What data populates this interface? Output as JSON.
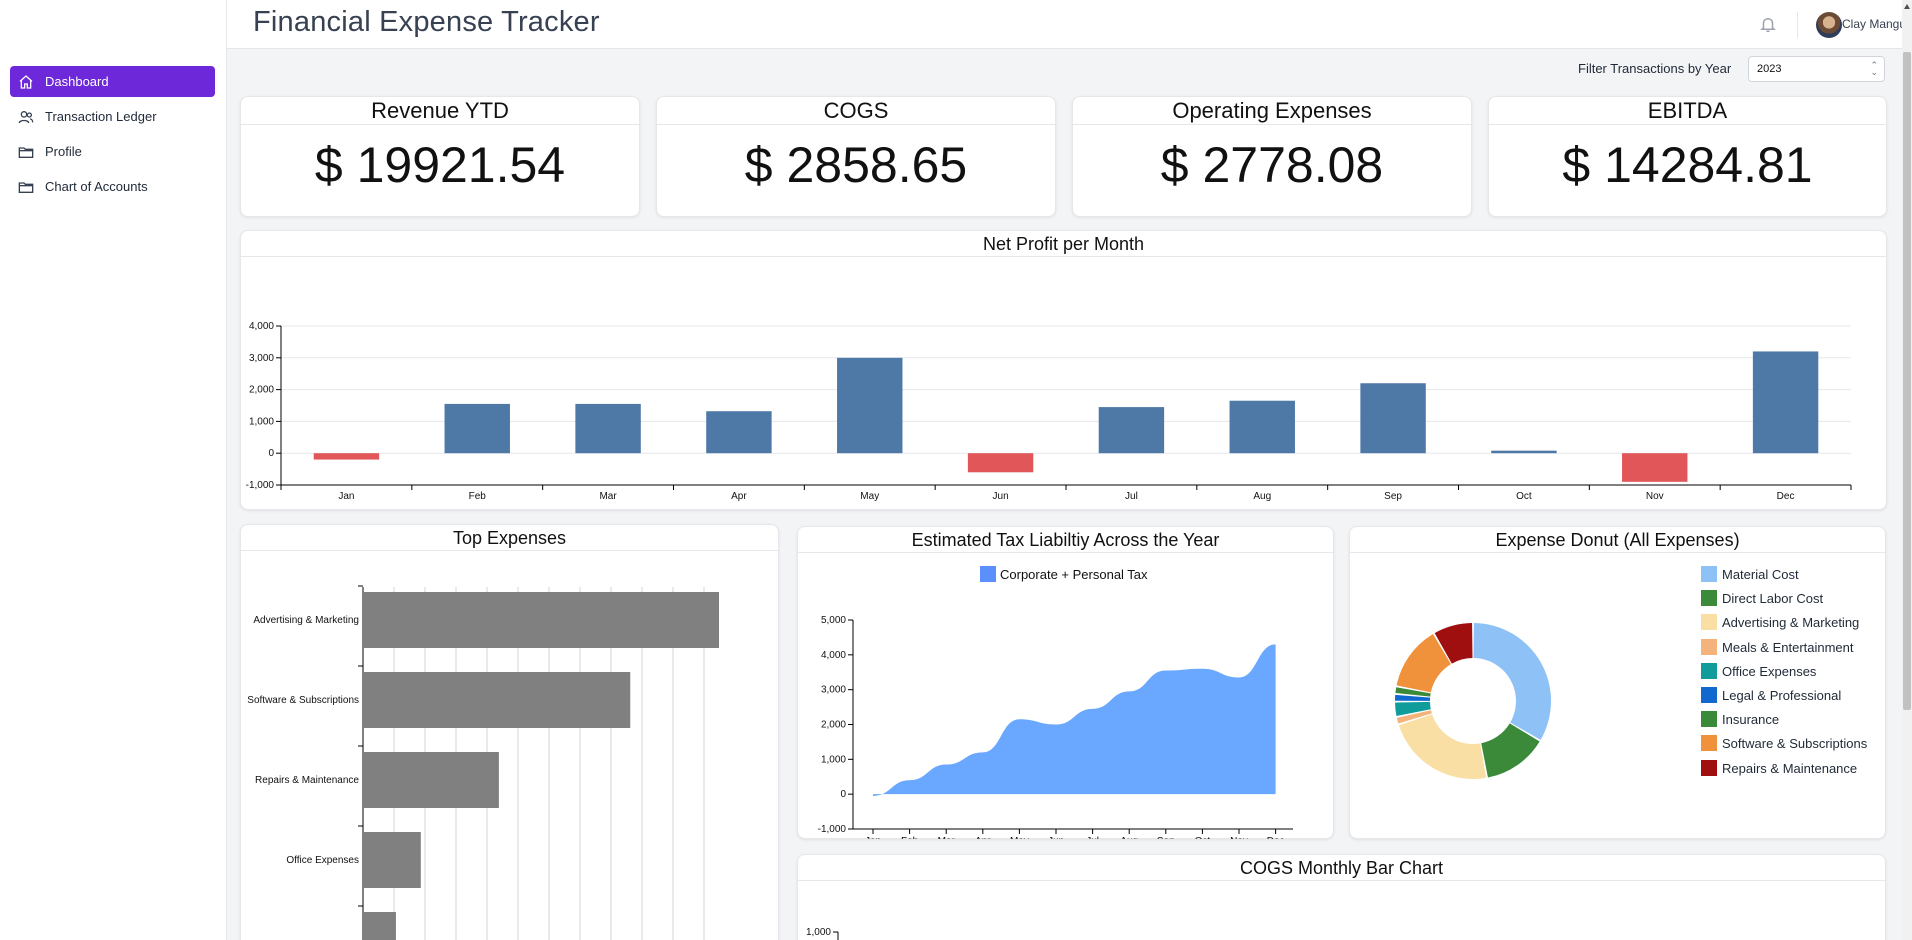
{
  "app": {
    "title": "Financial Expense Tracker"
  },
  "user": {
    "name": "Clay Mangum"
  },
  "sidebar": {
    "items": [
      {
        "label": "Dashboard",
        "icon": "home-icon",
        "active": true
      },
      {
        "label": "Transaction Ledger",
        "icon": "users-icon",
        "active": false
      },
      {
        "label": "Profile",
        "icon": "folder-icon",
        "active": false
      },
      {
        "label": "Chart of Accounts",
        "icon": "folder-icon",
        "active": false
      }
    ]
  },
  "filter": {
    "label": "Filter Transactions by Year",
    "value": "2023"
  },
  "kpis": [
    {
      "title": "Revenue YTD",
      "value": "$ 19921.54"
    },
    {
      "title": "COGS",
      "value": "$ 2858.65"
    },
    {
      "title": "Operating Expenses",
      "value": "$ 2778.08"
    },
    {
      "title": "EBITDA",
      "value": "$ 14284.81"
    }
  ],
  "colors": {
    "accent": "#6d28d9",
    "positive": "#4e79a7",
    "negative": "#e15759",
    "expense_bar": "#808080",
    "tax_area": "#6aa8ff",
    "cogs_bar": "#3b4a9a"
  },
  "chart_data": [
    {
      "type": "bar",
      "title": "Net Profit per Month",
      "categories": [
        "Jan",
        "Feb",
        "Mar",
        "Apr",
        "May",
        "Jun",
        "Jul",
        "Aug",
        "Sep",
        "Oct",
        "Nov",
        "Dec"
      ],
      "values": [
        -200,
        1550,
        1550,
        1320,
        3000,
        -600,
        1450,
        1650,
        2200,
        80,
        -900,
        3200
      ],
      "ylim": [
        -1000,
        4000
      ],
      "yticks": [
        "-1,000",
        "0",
        "1,000",
        "2,000",
        "3,000",
        "4,000"
      ],
      "grid": true
    },
    {
      "type": "bar",
      "orientation": "horizontal",
      "title": "Top Expenses",
      "categories": [
        "Advertising & Marketing",
        "Software & Subscriptions",
        "Repairs & Maintenance",
        "Office Expenses",
        ""
      ],
      "values": [
        1000,
        750,
        380,
        160,
        90
      ],
      "xlim": [
        0,
        1150
      ],
      "grid": true
    },
    {
      "type": "area",
      "title": "Estimated Tax Liabiltiy Across the Year",
      "series": [
        {
          "name": "Corporate + Personal Tax",
          "values": [
            -50,
            400,
            850,
            1200,
            2150,
            2000,
            2450,
            2950,
            3550,
            3600,
            3350,
            4300
          ]
        }
      ],
      "categories": [
        "Jan",
        "Feb",
        "Mar",
        "Apr",
        "May",
        "Jun",
        "Jul",
        "Aug",
        "Sep",
        "Oct",
        "Nov",
        "Dec"
      ],
      "ylim": [
        -1000,
        5000
      ],
      "yticks": [
        "-1,000",
        "0",
        "1,000",
        "2,000",
        "3,000",
        "4,000",
        "5,000"
      ],
      "legend": "top"
    },
    {
      "type": "pie",
      "title": "Expense Donut (All Expenses)",
      "labels": [
        "Material Cost",
        "Direct Labor Cost",
        "Advertising & Marketing",
        "Meals & Entertainment",
        "Office Expenses",
        "Legal & Professional",
        "Insurance",
        "Software & Subscriptions",
        "Repairs & Maintenance"
      ],
      "values": [
        32,
        13,
        22,
        1.5,
        3,
        1.5,
        1.5,
        13,
        8
      ],
      "colors": [
        "#8ec1f5",
        "#3a8a3a",
        "#f9dfa3",
        "#f5b37c",
        "#119c9c",
        "#1169cf",
        "#3a8a3a",
        "#f0923b",
        "#a00f0f"
      ],
      "legend": "right"
    },
    {
      "type": "bar",
      "title": "COGS Monthly Bar Chart",
      "yticks": [
        "1,000"
      ],
      "categories": [],
      "values": []
    }
  ]
}
